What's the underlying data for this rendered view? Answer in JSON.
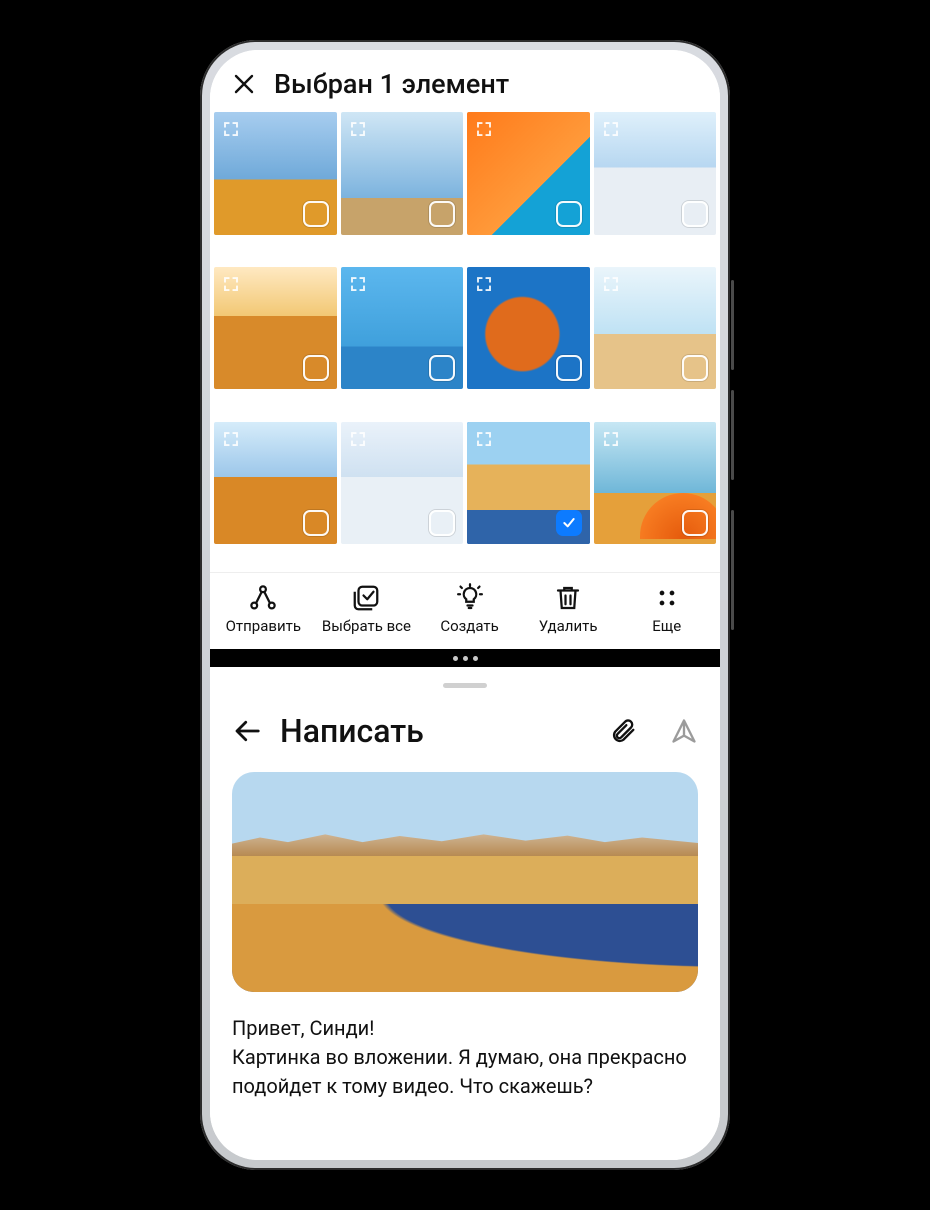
{
  "gallery": {
    "title": "Выбран 1 элемент",
    "thumbs": [
      {
        "name": "photo-woman-field",
        "selected": false
      },
      {
        "name": "photo-paper-boat",
        "selected": false
      },
      {
        "name": "photo-orange-flatlay",
        "selected": false
      },
      {
        "name": "photo-skier",
        "selected": false
      },
      {
        "name": "photo-camels-desert",
        "selected": false
      },
      {
        "name": "photo-colored-houses",
        "selected": false
      },
      {
        "name": "photo-rock-arch",
        "selected": false
      },
      {
        "name": "photo-deck-chairs",
        "selected": false
      },
      {
        "name": "photo-desert-rocks",
        "selected": false
      },
      {
        "name": "photo-snow-chairs",
        "selected": false
      },
      {
        "name": "photo-coastline",
        "selected": true
      },
      {
        "name": "photo-beach-umbrella",
        "selected": false
      }
    ],
    "actions": {
      "share": "Отправить",
      "select_all": "Выбрать все",
      "create": "Создать",
      "delete": "Удалить",
      "more": "Еще"
    }
  },
  "compose": {
    "title": "Написать",
    "greeting": "Привет, Синди!",
    "body": "Картинка во вложении. Я думаю, она прекрасно подойдет к тому видео. Что скажешь?"
  }
}
